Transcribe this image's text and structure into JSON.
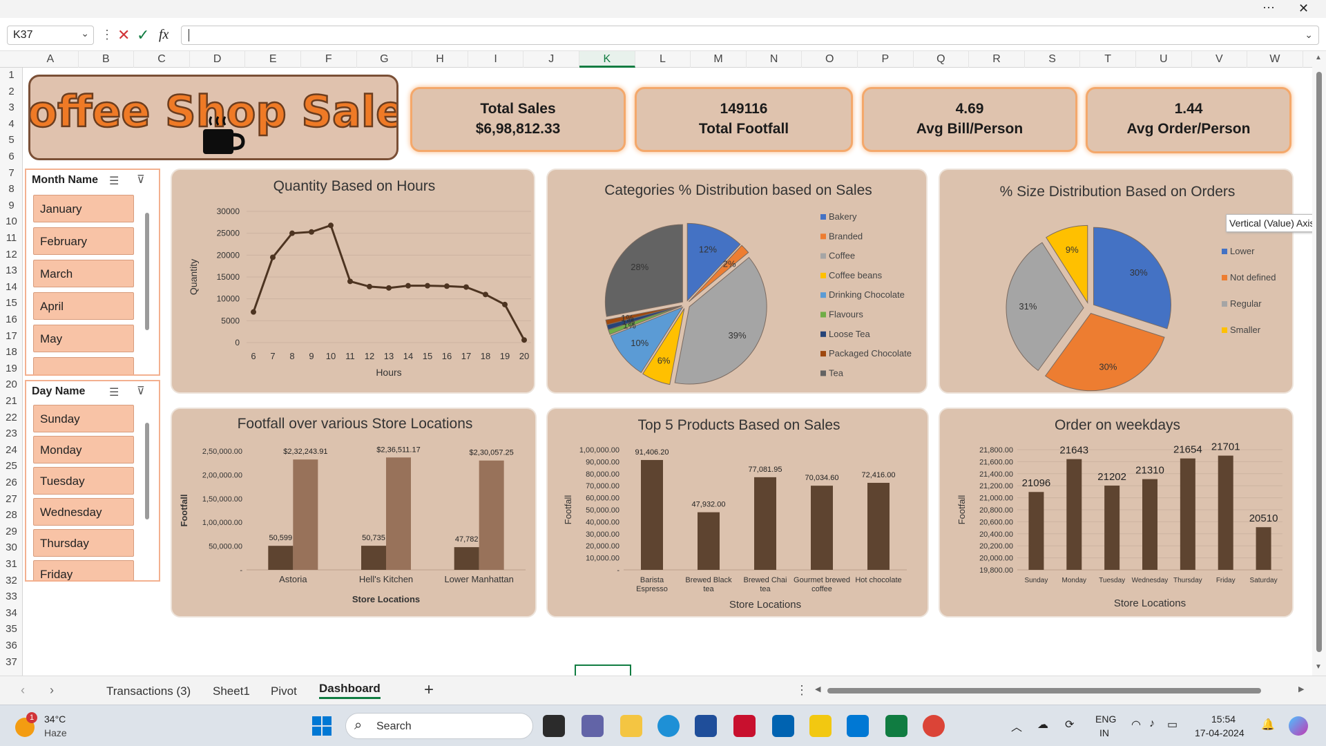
{
  "formula_bar": {
    "name_box": "K37",
    "fx": "fx"
  },
  "window": {
    "more": "···",
    "close": "✕"
  },
  "columns": [
    "A",
    "B",
    "C",
    "D",
    "E",
    "F",
    "G",
    "H",
    "I",
    "J",
    "K",
    "L",
    "M",
    "N",
    "O",
    "P",
    "Q",
    "R",
    "S",
    "T",
    "U",
    "V",
    "W"
  ],
  "rows": [
    "1",
    "2",
    "3",
    "4",
    "5",
    "6",
    "7",
    "8",
    "9",
    "10",
    "11",
    "12",
    "13",
    "14",
    "15",
    "16",
    "17",
    "18",
    "19",
    "20",
    "21",
    "22",
    "23",
    "24",
    "25",
    "26",
    "27",
    "28",
    "29",
    "30",
    "31",
    "32",
    "33",
    "34",
    "35",
    "36",
    "37"
  ],
  "dashboard": {
    "title": "Coffee Shop Sales",
    "kpis": [
      {
        "line1": "Total Sales",
        "line2": "$6,98,812.33"
      },
      {
        "line1": "149116",
        "line2": "Total Footfall"
      },
      {
        "line1": "4.69",
        "line2": "Avg Bill/Person"
      },
      {
        "line1": "1.44",
        "line2": "Avg Order/Person"
      }
    ],
    "month_slicer": {
      "title": "Month Name",
      "items": [
        "January",
        "February",
        "March",
        "April",
        "May",
        ""
      ]
    },
    "day_slicer": {
      "title": "Day Name",
      "items": [
        "Sunday",
        "Monday",
        "Tuesday",
        "Wednesday",
        "Thursday",
        "Friday"
      ]
    },
    "tooltip": "Vertical (Value) Axis"
  },
  "chart_data": [
    {
      "id": "hours",
      "type": "line",
      "title": "Quantity Based on Hours",
      "xlabel": "Hours",
      "ylabel": "Quantity",
      "x": [
        6,
        7,
        8,
        9,
        10,
        11,
        12,
        13,
        14,
        15,
        16,
        17,
        18,
        19,
        20
      ],
      "values": [
        7000,
        19500,
        25000,
        25300,
        26800,
        14000,
        12800,
        12500,
        13000,
        13000,
        12900,
        12700,
        11000,
        8700,
        600
      ],
      "yticks": [
        "30000",
        "25000",
        "20000",
        "15000",
        "10000",
        "5000",
        "0"
      ],
      "ylim": [
        0,
        30000
      ]
    },
    {
      "id": "categories",
      "type": "pie",
      "title": "Categories % Distribution based on Sales",
      "categories": [
        "Bakery",
        "Branded",
        "Coffee",
        "Coffee beans",
        "Drinking Chocolate",
        "Flavours",
        "Loose Tea",
        "Packaged Chocolate",
        "Tea"
      ],
      "values": [
        12,
        2,
        39,
        6,
        10,
        1,
        1,
        1,
        28
      ],
      "labels": [
        "12%",
        "2%",
        "39%",
        "6%",
        "10%",
        "1%",
        "1%",
        "1%",
        "28%"
      ],
      "colors": [
        "#4472c4",
        "#ed7d31",
        "#a5a5a5",
        "#ffc000",
        "#5b9bd5",
        "#70ad47",
        "#264478",
        "#9e480e",
        "#636363"
      ],
      "legend": "right"
    },
    {
      "id": "sizes",
      "type": "pie",
      "title": "% Size  Distribution Based on Orders",
      "categories": [
        "Lower",
        "Not defined",
        "Regular",
        "Smaller"
      ],
      "values": [
        30,
        30,
        31,
        9
      ],
      "labels": [
        "30%",
        "30%",
        "31%",
        "9%"
      ],
      "colors": [
        "#4472c4",
        "#ed7d31",
        "#a5a5a5",
        "#ffc000"
      ],
      "legend": "right"
    },
    {
      "id": "footfall",
      "type": "bar",
      "title": "Footfall over various Store Locations",
      "xlabel": "Store Locations",
      "ylabel": "Footfall",
      "categories": [
        "Astoria",
        "Hell's Kitchen",
        "Lower Manhattan"
      ],
      "series": [
        {
          "values": [
            50599,
            50735,
            47782
          ],
          "labels": [
            "50,599",
            "50,735",
            "47,782"
          ],
          "color": "#5e4430"
        },
        {
          "values": [
            232243.91,
            236511.17,
            230057.25
          ],
          "labels": [
            "$2,32,243.91",
            "$2,36,511.17",
            "$2,30,057.25"
          ],
          "color": "#98725a"
        }
      ],
      "yticks": [
        "2,50,000.00",
        "2,00,000.00",
        "1,50,000.00",
        "1,00,000.00",
        "50,000.00",
        "-"
      ],
      "ylim": [
        0,
        250000
      ]
    },
    {
      "id": "top5",
      "type": "bar",
      "title": "Top 5 Products Based on Sales",
      "xlabel": "Store Locations",
      "ylabel": "Footfall",
      "categories": [
        "Barista Espresso",
        "Brewed Black tea",
        "Brewed Chai tea",
        "Gourmet brewed coffee",
        "Hot chocolate"
      ],
      "values": [
        91406.2,
        47932.0,
        77081.95,
        70034.6,
        72416.0
      ],
      "labels": [
        "91,406.20",
        "47,932.00",
        "77,081.95",
        "70,034.60",
        "72,416.00"
      ],
      "yticks": [
        "1,00,000.00",
        "90,000.00",
        "80,000.00",
        "70,000.00",
        "60,000.00",
        "50,000.00",
        "40,000.00",
        "30,000.00",
        "20,000.00",
        "10,000.00",
        "-"
      ],
      "ylim": [
        0,
        100000
      ],
      "color": "#5e4430"
    },
    {
      "id": "weekdays",
      "type": "bar",
      "title": "Order on weekdays",
      "xlabel": "Store Locations",
      "ylabel": "Footfall",
      "categories": [
        "Sunday",
        "Monday",
        "Tuesday",
        "Wednesday",
        "Thursday",
        "Friday",
        "Saturday"
      ],
      "values": [
        21096,
        21643,
        21202,
        21310,
        21654,
        21701,
        20510
      ],
      "labels": [
        "21096",
        "21643",
        "21202",
        "21310",
        "21654",
        "21701",
        "20510"
      ],
      "yticks": [
        "21,800.00",
        "21,600.00",
        "21,400.00",
        "21,200.00",
        "21,000.00",
        "20,800.00",
        "20,600.00",
        "20,400.00",
        "20,200.00",
        "20,000.00",
        "19,800.00"
      ],
      "ylim": [
        19800,
        21800
      ],
      "color": "#5e4430"
    }
  ],
  "sheet_tabs": {
    "tabs": [
      "Transactions (3)",
      "Sheet1",
      "Pivot",
      "Dashboard"
    ],
    "active": "Dashboard",
    "add": "+"
  },
  "taskbar": {
    "weather_temp": "34°C",
    "weather_desc": "Haze",
    "weather_badge": "1",
    "search": "Search",
    "lang1": "ENG",
    "lang2": "IN",
    "time": "15:54",
    "date": "17-04-2024"
  }
}
